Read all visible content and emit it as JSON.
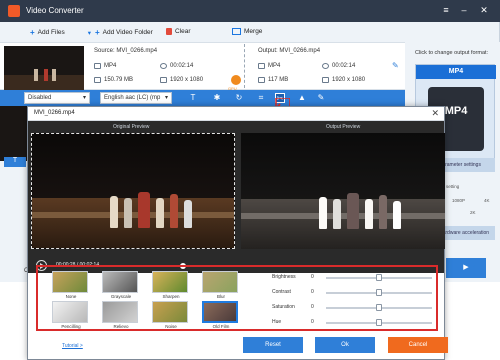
{
  "app": {
    "title": "Video Converter",
    "accent": "#2f7fd8",
    "cancel_color": "#f06a1e",
    "highlight_color": "#d92b2b"
  },
  "toolbar": {
    "add_files": "Add Files",
    "add_folder": "Add Video Folder",
    "clear": "Clear",
    "merge": "Merge"
  },
  "source": {
    "label": "Source: MVI_0266.mp4",
    "format": "MP4",
    "duration": "00:02:14",
    "size": "150.79 MB",
    "resolution": "1920 x 1080"
  },
  "output": {
    "label": "Output: MVI_0266.mp4",
    "format": "MP4",
    "duration": "00:02:14",
    "size": "117 MB",
    "resolution": "1920 x 1080"
  },
  "gpu_label": "GPU",
  "edit_bar": {
    "subtitle": "Disabled",
    "audio": "English aac (LC) (mp"
  },
  "right_panel": {
    "title": "Click to change output format:",
    "format": "MP4",
    "format_tag": "MP4",
    "settings_btn": "Parameter settings",
    "setting_label": "setting",
    "res_low": "1080P",
    "res_2k": "2K",
    "res_4k": "4K",
    "accel_btn": "Hardware acceleration"
  },
  "left_hint": "C",
  "dialog": {
    "filename": "MVI_0266.mp4",
    "original_label": "Original Preview",
    "output_label": "Output Preview",
    "time": "00:00:28 / 00:02:14",
    "progress": 0.21
  },
  "filters": [
    {
      "name": "None",
      "selected": false
    },
    {
      "name": "Grayscale",
      "selected": false
    },
    {
      "name": "Sharpen",
      "selected": false
    },
    {
      "name": "Blur",
      "selected": false
    },
    {
      "name": "Pencilling",
      "selected": false
    },
    {
      "name": "Relievo",
      "selected": false
    },
    {
      "name": "Noise",
      "selected": false
    },
    {
      "name": "Old Film",
      "selected": true
    }
  ],
  "adjustments": [
    {
      "name": "Brightness",
      "value": "0",
      "level": 0.5
    },
    {
      "name": "Contrast",
      "value": "0",
      "level": 0.5
    },
    {
      "name": "Saturation",
      "value": "0",
      "level": 0.5
    },
    {
      "name": "Hue",
      "value": "0",
      "level": 0.5
    }
  ],
  "footer": {
    "tutorial": "Tutorial >",
    "reset": "Reset",
    "ok": "Ok",
    "cancel": "Cancel"
  }
}
